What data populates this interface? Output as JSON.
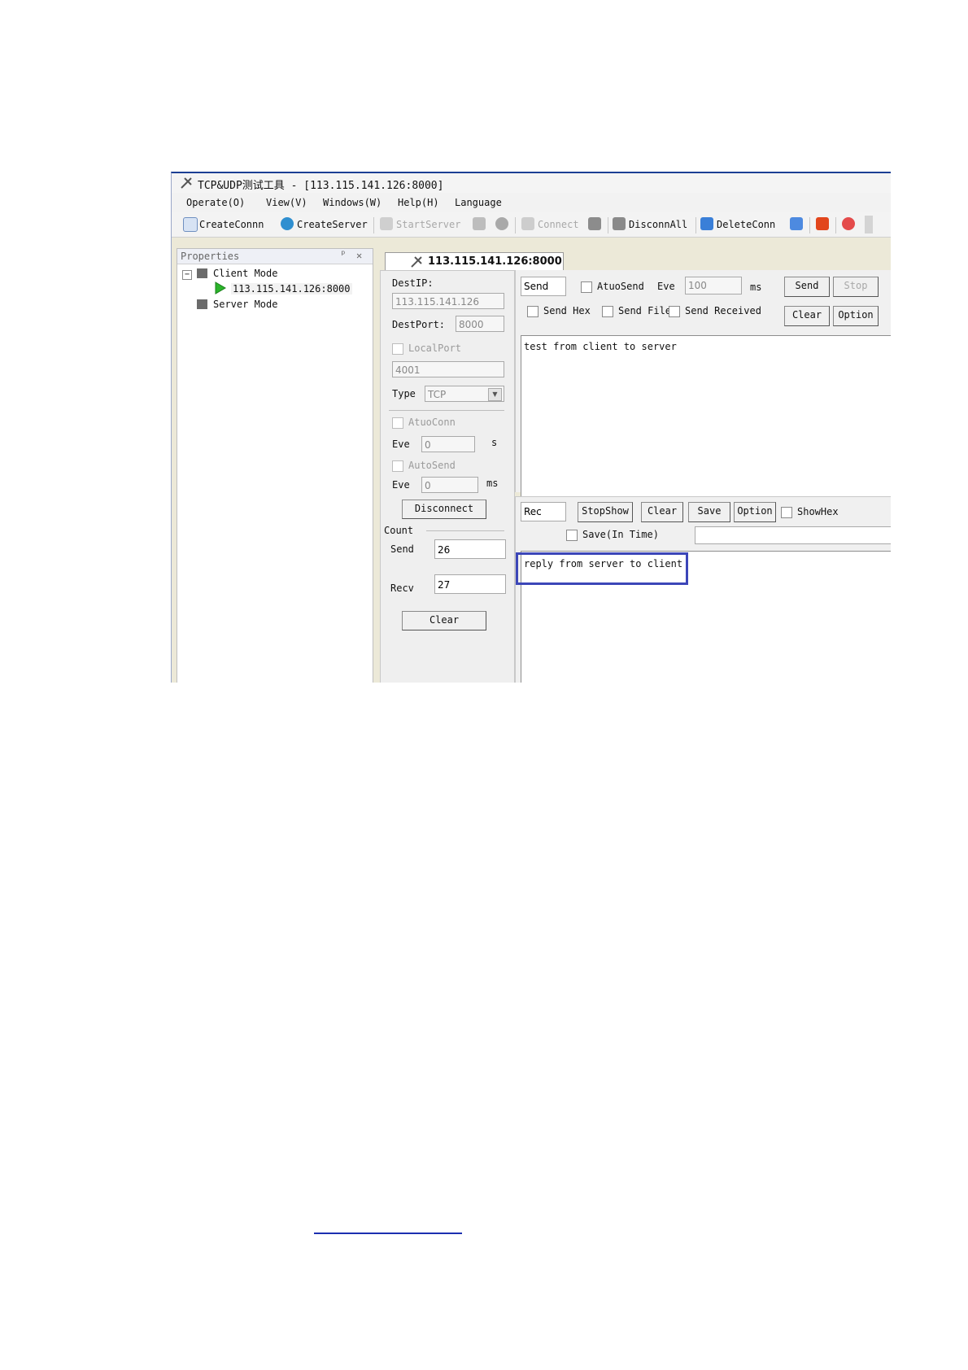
{
  "window": {
    "title": "TCP&UDP测试工具 - [113.115.141.126:8000]",
    "menu": [
      "Operate(O)",
      "View(V)",
      "Windows(W)",
      "Help(H)",
      "Language"
    ],
    "toolbar": {
      "create_conn": "CreateConnn",
      "create_server": "CreateServer",
      "start_server": "StartServer",
      "connect": "Connect",
      "disconn_all": "DisconnAll",
      "delete_conn": "DeleteConn"
    }
  },
  "properties": {
    "header": "Properties",
    "pin": "ᵖ",
    "close": "✕",
    "tree": {
      "client_mode": "Client Mode",
      "connection": "113.115.141.126:8000",
      "server_mode": "Server Mode",
      "expander": "−"
    }
  },
  "tab": {
    "label": "113.115.141.126:8000"
  },
  "settings": {
    "dest_ip_label": "DestIP:",
    "dest_ip": "113.115.141.126",
    "dest_port_label": "DestPort:",
    "dest_port": "8000",
    "local_port_label": "LocalPort",
    "local_port": "4001",
    "type_label": "Type",
    "type_value": "TCP",
    "atuo_conn_label": "AtuoConn",
    "eve_label": "Eve",
    "eve_value": "0",
    "eve_unit": "s",
    "auto_send_label": "AutoSend",
    "eve2_label": "Eve",
    "eve2_value": "0",
    "eve2_unit": "ms",
    "disconnect": "Disconnect",
    "count_label": "Count",
    "send_label": "Send",
    "send_count": "26",
    "recv_label": "Recv",
    "recv_count": "27",
    "clear": "Clear"
  },
  "send_panel": {
    "send_box": "Send",
    "atuo_send": "AtuoSend",
    "eve_label": "Eve",
    "eve_value": "100",
    "ms": "ms",
    "send_btn": "Send",
    "stop_btn": "Stop",
    "send_hex": "Send Hex",
    "send_file": "Send File",
    "send_received": "Send Received",
    "clear_btn": "Clear",
    "option_btn": "Option",
    "text": "test from client to server"
  },
  "recv_panel": {
    "rec_box": "Rec",
    "stop_show": "StopShow",
    "clear": "Clear",
    "save": "Save",
    "option": "Option",
    "show_hex": "ShowHex",
    "save_in_time": "Save(In Time)",
    "text": "reply from server to client"
  },
  "colors": {
    "highlight": "#3c46b8",
    "title_accent": "#1c3f94",
    "link": "#1c2fb0"
  }
}
